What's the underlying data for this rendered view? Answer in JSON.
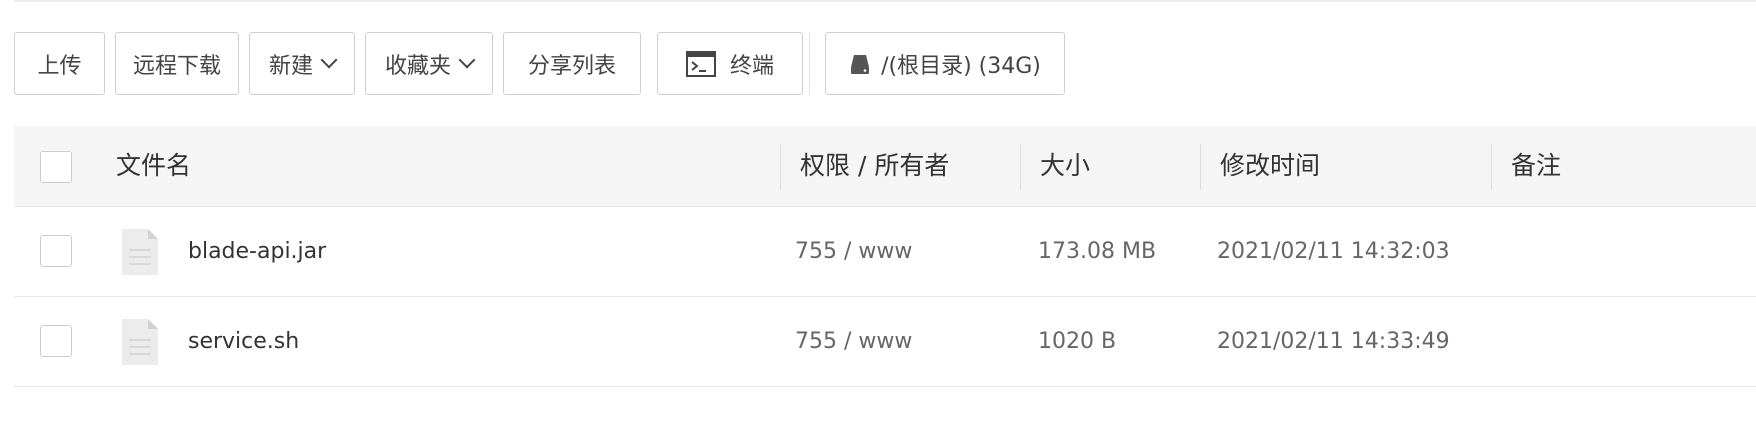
{
  "toolbar": {
    "upload": "上传",
    "remote_download": "远程下载",
    "new": "新建",
    "favorites": "收藏夹",
    "share_list": "分享列表",
    "terminal": "终端",
    "disk": "/(根目录) (34G)"
  },
  "table": {
    "columns": {
      "name": "文件名",
      "permission": "权限 / 所有者",
      "size": "大小",
      "modified": "修改时间",
      "remark": "备注"
    },
    "rows": [
      {
        "name": "blade-api.jar",
        "permission": "755 / www",
        "size": "173.08 MB",
        "modified": "2021/02/11 14:32:03",
        "remark": ""
      },
      {
        "name": "service.sh",
        "permission": "755 / www",
        "size": "1020 B",
        "modified": "2021/02/11 14:33:49",
        "remark": ""
      }
    ]
  },
  "icons": {
    "terminal": "terminal-icon",
    "disk": "hard-drive-icon",
    "file": "file-icon",
    "dropdown": "chevron-down-icon"
  }
}
